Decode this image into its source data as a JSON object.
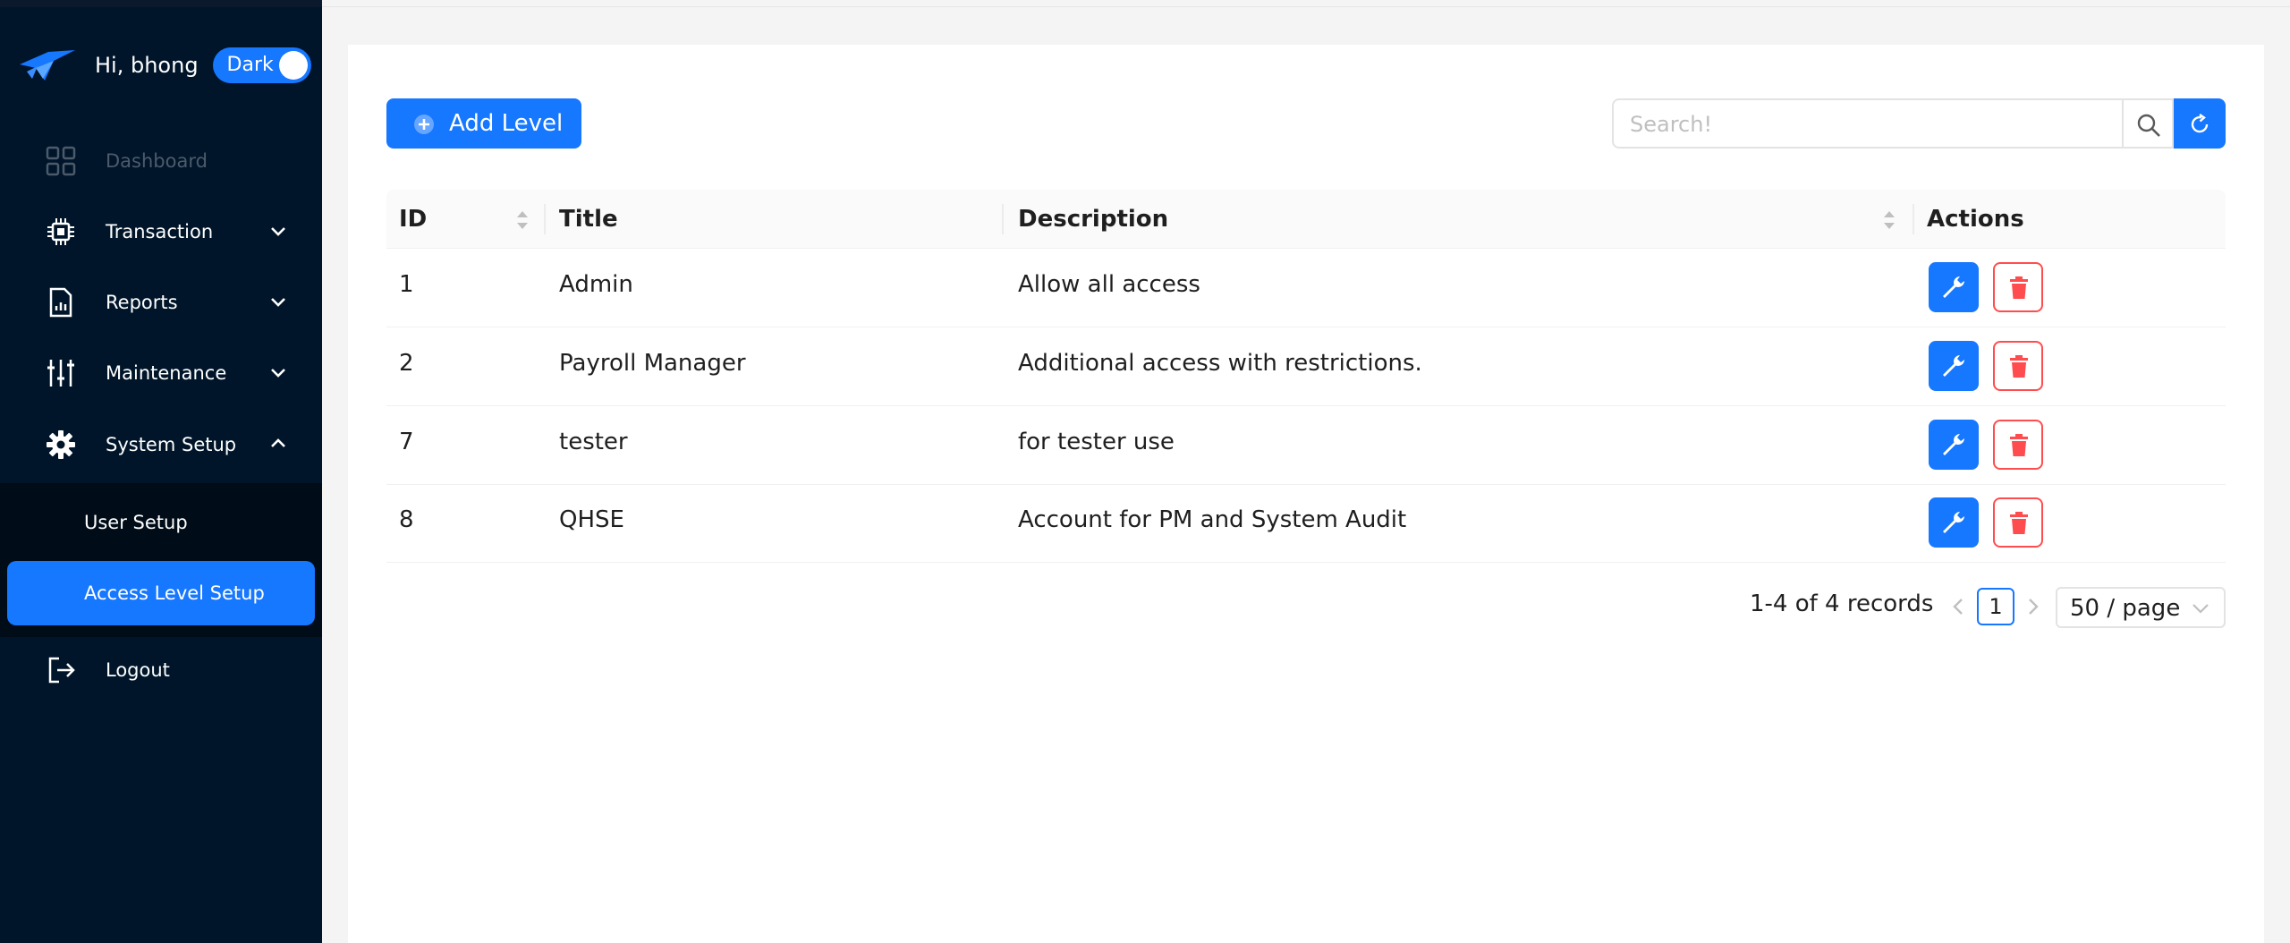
{
  "sidebar": {
    "greeting": "Hi, bhong",
    "theme_toggle": "Dark",
    "menu": [
      {
        "label": "Dashboard",
        "icon": "dashboard-icon"
      },
      {
        "label": "Transaction",
        "icon": "chip-icon"
      },
      {
        "label": "Reports",
        "icon": "report-icon"
      },
      {
        "label": "Maintenance",
        "icon": "sliders-icon"
      },
      {
        "label": "System Setup",
        "icon": "gear-icon"
      }
    ],
    "submenu": [
      {
        "label": "User Setup"
      },
      {
        "label": "Access Level Setup"
      }
    ],
    "logout": {
      "label": "Logout",
      "icon": "logout-icon"
    }
  },
  "toolbar": {
    "add_label": "Add Level",
    "search_placeholder": "Search!"
  },
  "table": {
    "columns": [
      "ID",
      "Title",
      "Description",
      "Actions"
    ],
    "rows": [
      {
        "id": "1",
        "title": "Admin",
        "description": "Allow all access"
      },
      {
        "id": "2",
        "title": "Payroll Manager",
        "description": "Additional access with restrictions."
      },
      {
        "id": "7",
        "title": "tester",
        "description": "for tester use"
      },
      {
        "id": "8",
        "title": "QHSE",
        "description": "Account for PM and System Audit"
      }
    ]
  },
  "pagination": {
    "total": "1-4 of 4 records",
    "current_page": "1",
    "page_size": "50 / page"
  },
  "colors": {
    "primary": "#1677ff",
    "sidebar_bg": "#001529",
    "danger": "#ff4d4f"
  }
}
